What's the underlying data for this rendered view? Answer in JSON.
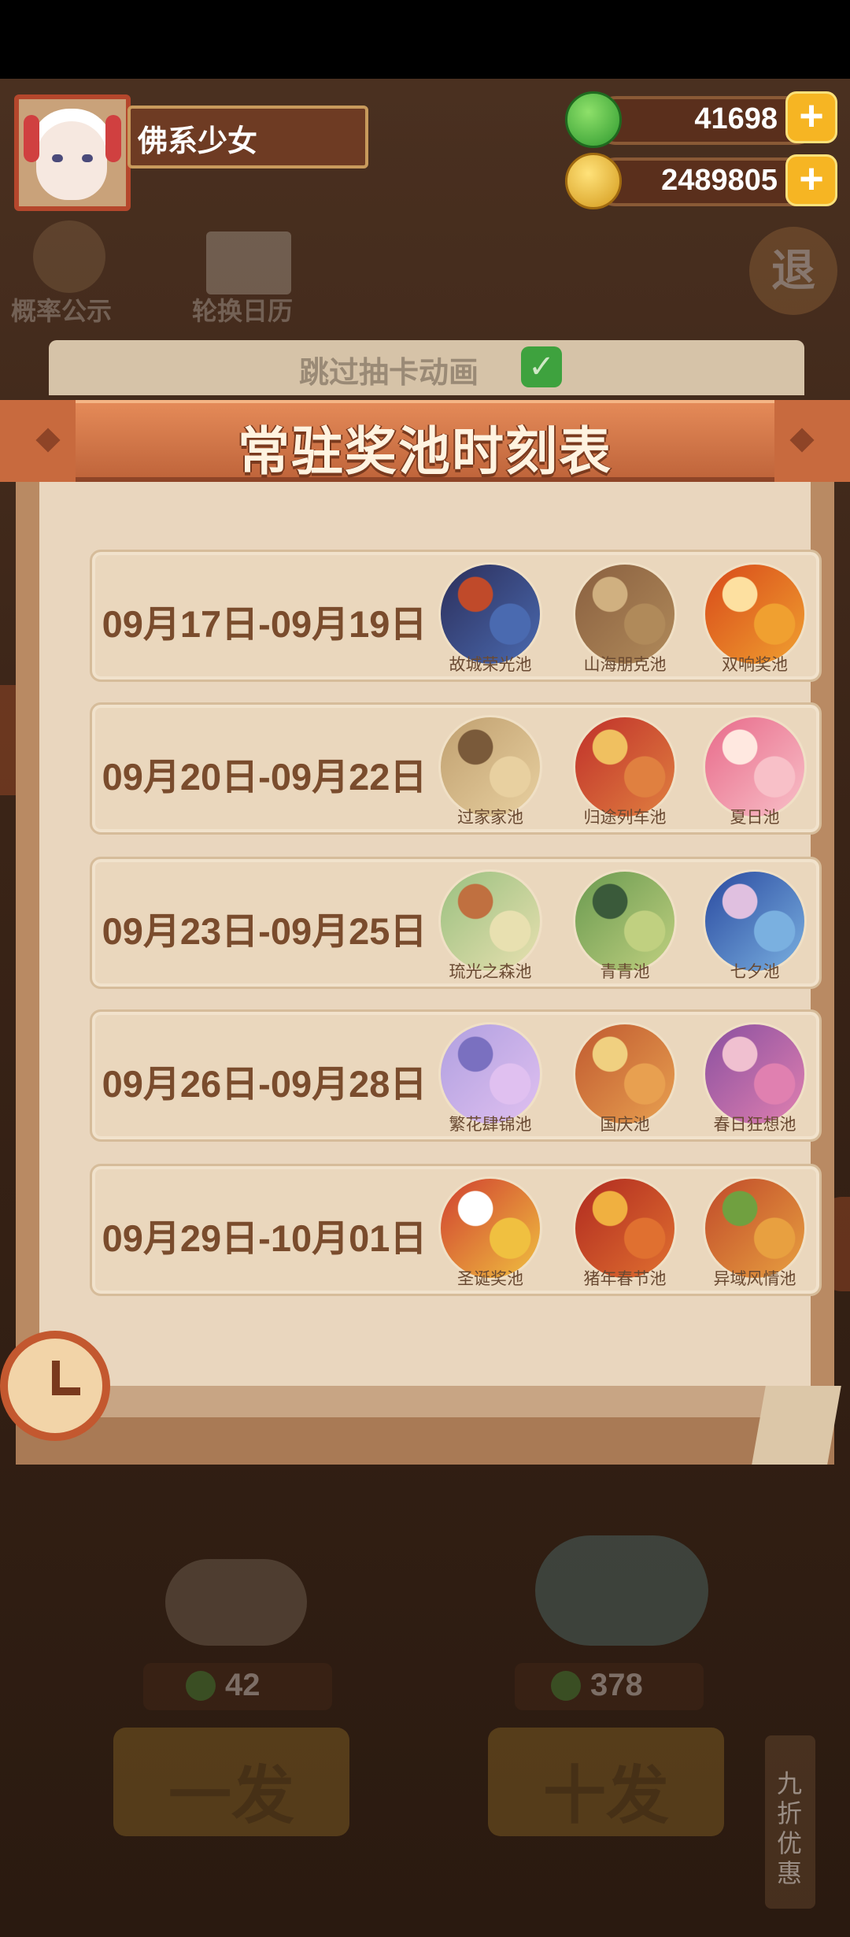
{
  "header": {
    "username": "佛系少女",
    "currency_green": "41698",
    "currency_gold": "2489805",
    "plus_label": "+"
  },
  "tools": {
    "probability": "概率公示",
    "calendar": "轮换日历",
    "exit": "退"
  },
  "skip": {
    "label": "跳过抽卡动画",
    "check": "✓"
  },
  "modal": {
    "title": "常驻奖池时刻表",
    "rows": [
      {
        "date": "09月17日-09月19日",
        "pools": [
          {
            "name": "故城荣光池",
            "colors": [
              "#2c2e5a",
              "#4a6ab0",
              "#c04a2a"
            ]
          },
          {
            "name": "山海朋克池",
            "colors": [
              "#8a6040",
              "#b08a5a",
              "#d0b080"
            ]
          },
          {
            "name": "双响奖池",
            "colors": [
              "#d84a1a",
              "#f0a030",
              "#fde0a0"
            ]
          }
        ]
      },
      {
        "date": "09月20日-09月22日",
        "pools": [
          {
            "name": "过家家池",
            "colors": [
              "#c0a070",
              "#e8d0a0",
              "#7a5a3a"
            ]
          },
          {
            "name": "归途列车池",
            "colors": [
              "#c0302a",
              "#e08040",
              "#f0c060"
            ]
          },
          {
            "name": "夏日池",
            "colors": [
              "#e86a8a",
              "#f8c0c8",
              "#ffe8e0"
            ]
          }
        ]
      },
      {
        "date": "09月23日-09月25日",
        "pools": [
          {
            "name": "琉光之森池",
            "colors": [
              "#9ac080",
              "#e8e0b0",
              "#c07040"
            ]
          },
          {
            "name": "青青池",
            "colors": [
              "#6a9a50",
              "#c0d080",
              "#3a5a3a"
            ]
          },
          {
            "name": "七夕池",
            "colors": [
              "#2a4aa0",
              "#7ab0e0",
              "#e0c0e0"
            ]
          }
        ]
      },
      {
        "date": "09月26日-09月28日",
        "pools": [
          {
            "name": "繁花肆锦池",
            "colors": [
              "#b0a0e0",
              "#e0c0f0",
              "#7a70c0"
            ]
          },
          {
            "name": "国庆池",
            "colors": [
              "#c05a30",
              "#e8a050",
              "#f0d080"
            ]
          },
          {
            "name": "春日狂想池",
            "colors": [
              "#8a50a0",
              "#e080b0",
              "#f0c0d0"
            ]
          }
        ]
      },
      {
        "date": "09月29日-10月01日",
        "pools": [
          {
            "name": "圣诞奖池",
            "colors": [
              "#d04030",
              "#f0c040",
              "#ffffff"
            ]
          },
          {
            "name": "猪年春节池",
            "colors": [
              "#b02a20",
              "#e07030",
              "#f0b040"
            ]
          },
          {
            "name": "异域风情池",
            "colors": [
              "#c04a2a",
              "#e8a040",
              "#70a040"
            ]
          }
        ]
      }
    ]
  },
  "bottom": {
    "cost_single": "42",
    "cost_ten": "378",
    "btn_single": "一发",
    "btn_ten": "十发",
    "discount": "九折优惠"
  }
}
